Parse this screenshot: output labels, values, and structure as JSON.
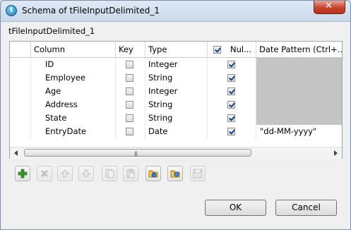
{
  "window": {
    "title": "Schema of tFileInputDelimited_1",
    "close_glyph": "✕"
  },
  "dialog_label": "tFileInputDelimited_1",
  "table": {
    "headers": {
      "column": "Column",
      "key": "Key",
      "type": "Type",
      "nullable": "Nul...",
      "date_pattern": "Date Pattern (Ctrl+..."
    },
    "rows": [
      {
        "name": "ID",
        "key": false,
        "type": "Integer",
        "nullable": true,
        "date_pattern": ""
      },
      {
        "name": "Employee",
        "key": false,
        "type": "String",
        "nullable": true,
        "date_pattern": ""
      },
      {
        "name": "Age",
        "key": false,
        "type": "Integer",
        "nullable": true,
        "date_pattern": ""
      },
      {
        "name": "Address",
        "key": false,
        "type": "String",
        "nullable": true,
        "date_pattern": ""
      },
      {
        "name": "State",
        "key": false,
        "type": "String",
        "nullable": true,
        "date_pattern": ""
      },
      {
        "name": "EntryDate",
        "key": false,
        "type": "Date",
        "nullable": true,
        "date_pattern": "\"dd-MM-yyyy\""
      }
    ],
    "scroll_grip": "|||"
  },
  "toolbar": [
    "add-icon",
    "delete-icon",
    "move-up-icon",
    "move-down-icon",
    "copy-icon",
    "paste-icon",
    "import-icon",
    "export-icon",
    "save-icon"
  ],
  "buttons": {
    "ok": "OK",
    "cancel": "Cancel"
  }
}
